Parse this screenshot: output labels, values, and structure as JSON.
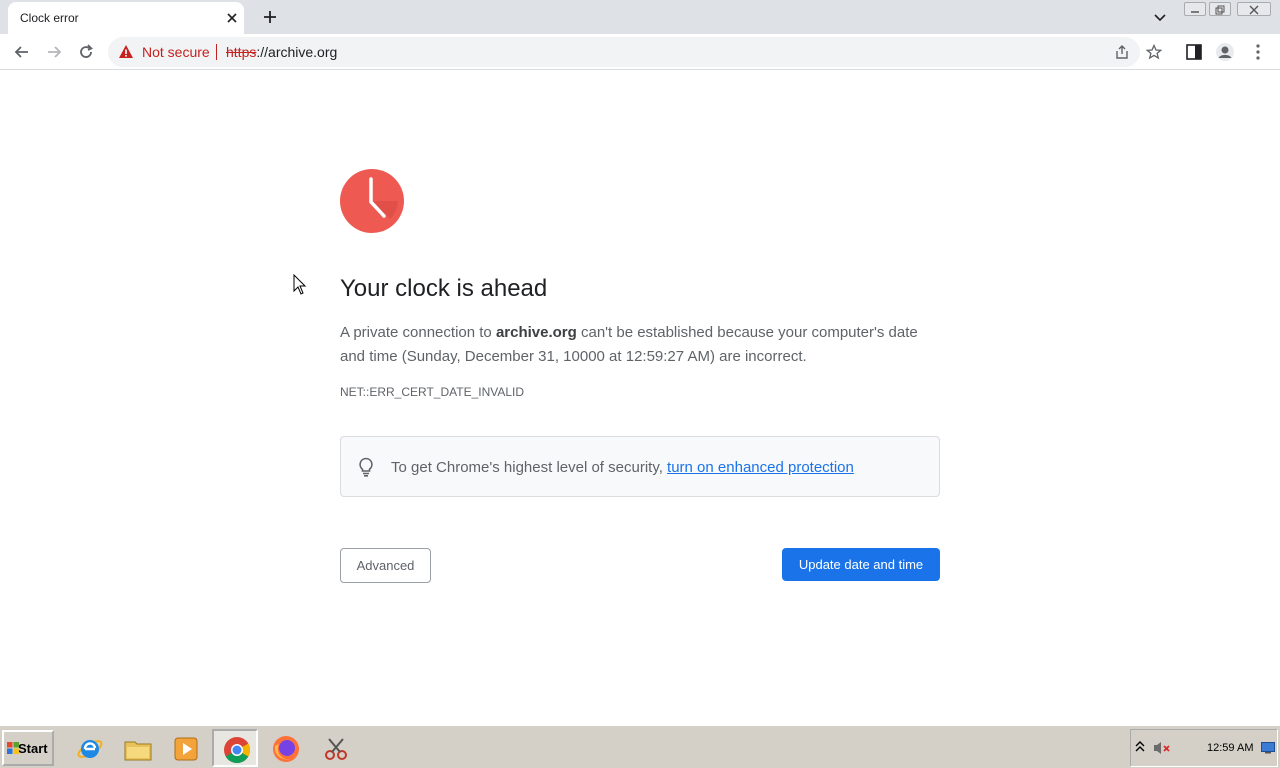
{
  "browser": {
    "tab_title": "Clock error",
    "security_label": "Not secure",
    "url_scheme": "https",
    "url_rest": "://archive.org"
  },
  "page": {
    "heading": "Your clock is ahead",
    "body_prefix": "A private connection to ",
    "body_domain": "archive.org",
    "body_suffix": " can't be established because your computer's date and time (Sunday, December 31, 10000 at 12:59:27 AM) are incorrect.",
    "error_code": "NET::ERR_CERT_DATE_INVALID",
    "tip_text": "To get Chrome's highest level of security, ",
    "tip_link": "turn on enhanced protection",
    "advanced_button": "Advanced",
    "update_button": "Update date and time"
  },
  "taskbar": {
    "start_label": "Start",
    "apps": [
      "internet-explorer",
      "file-explorer",
      "media-player",
      "chrome",
      "firefox",
      "snipping-tool"
    ],
    "time": "12:59 AM"
  },
  "colors": {
    "accent": "#1a73e8",
    "error": "#c5221f",
    "clock": "#ee5a52"
  }
}
